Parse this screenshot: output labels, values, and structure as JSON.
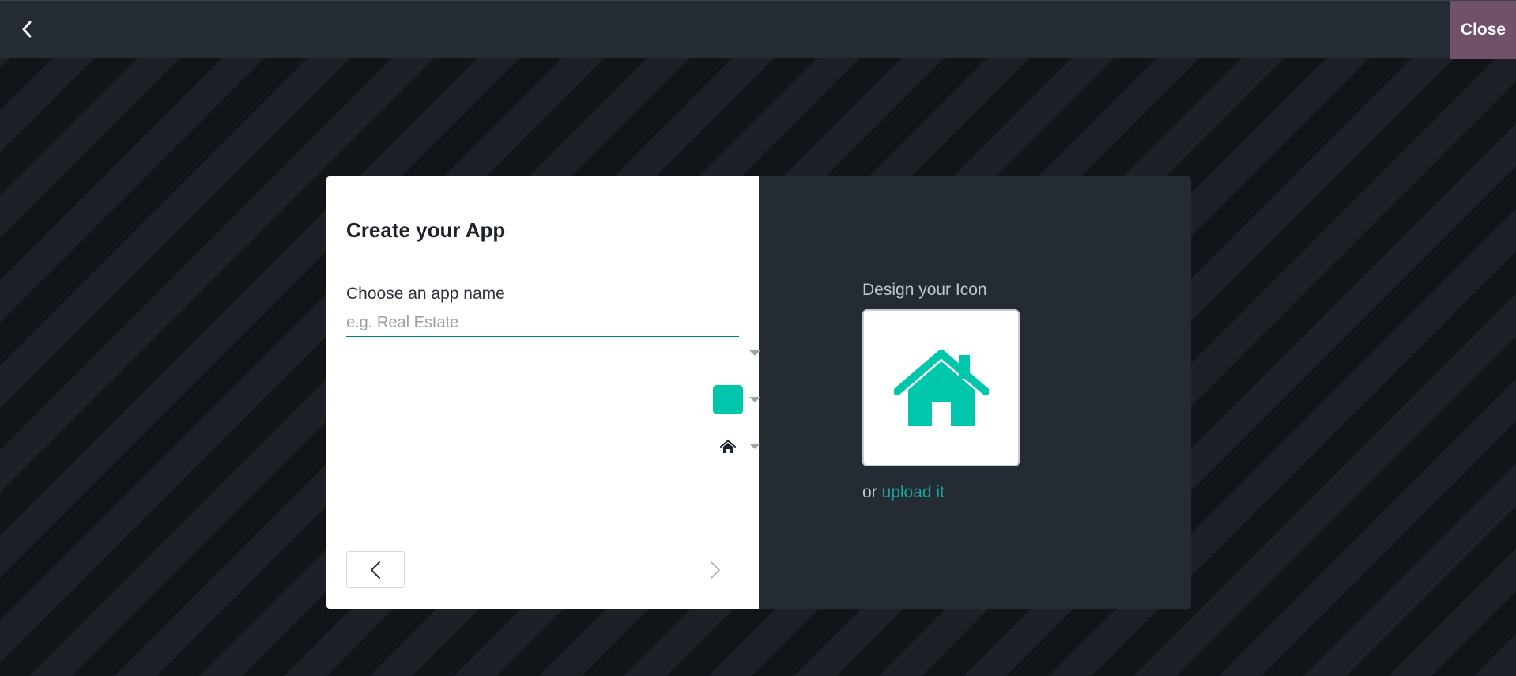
{
  "topbar": {
    "close_label": "Close"
  },
  "dialog": {
    "title": "Create your App",
    "app_name_label": "Choose an app name",
    "app_name_value": "",
    "app_name_placeholder": "e.g. Real Estate"
  },
  "icon_designer": {
    "label": "Design your Icon",
    "background_color": "#ffffff",
    "icon_color": "#00c7ac",
    "icon_name": "home-icon",
    "upload_prefix": "or",
    "upload_link": "upload it"
  },
  "colors": {
    "topbar_bg": "#252b33",
    "close_bg": "#71506a",
    "accent": "#017e84",
    "link": "#1aa39f"
  }
}
